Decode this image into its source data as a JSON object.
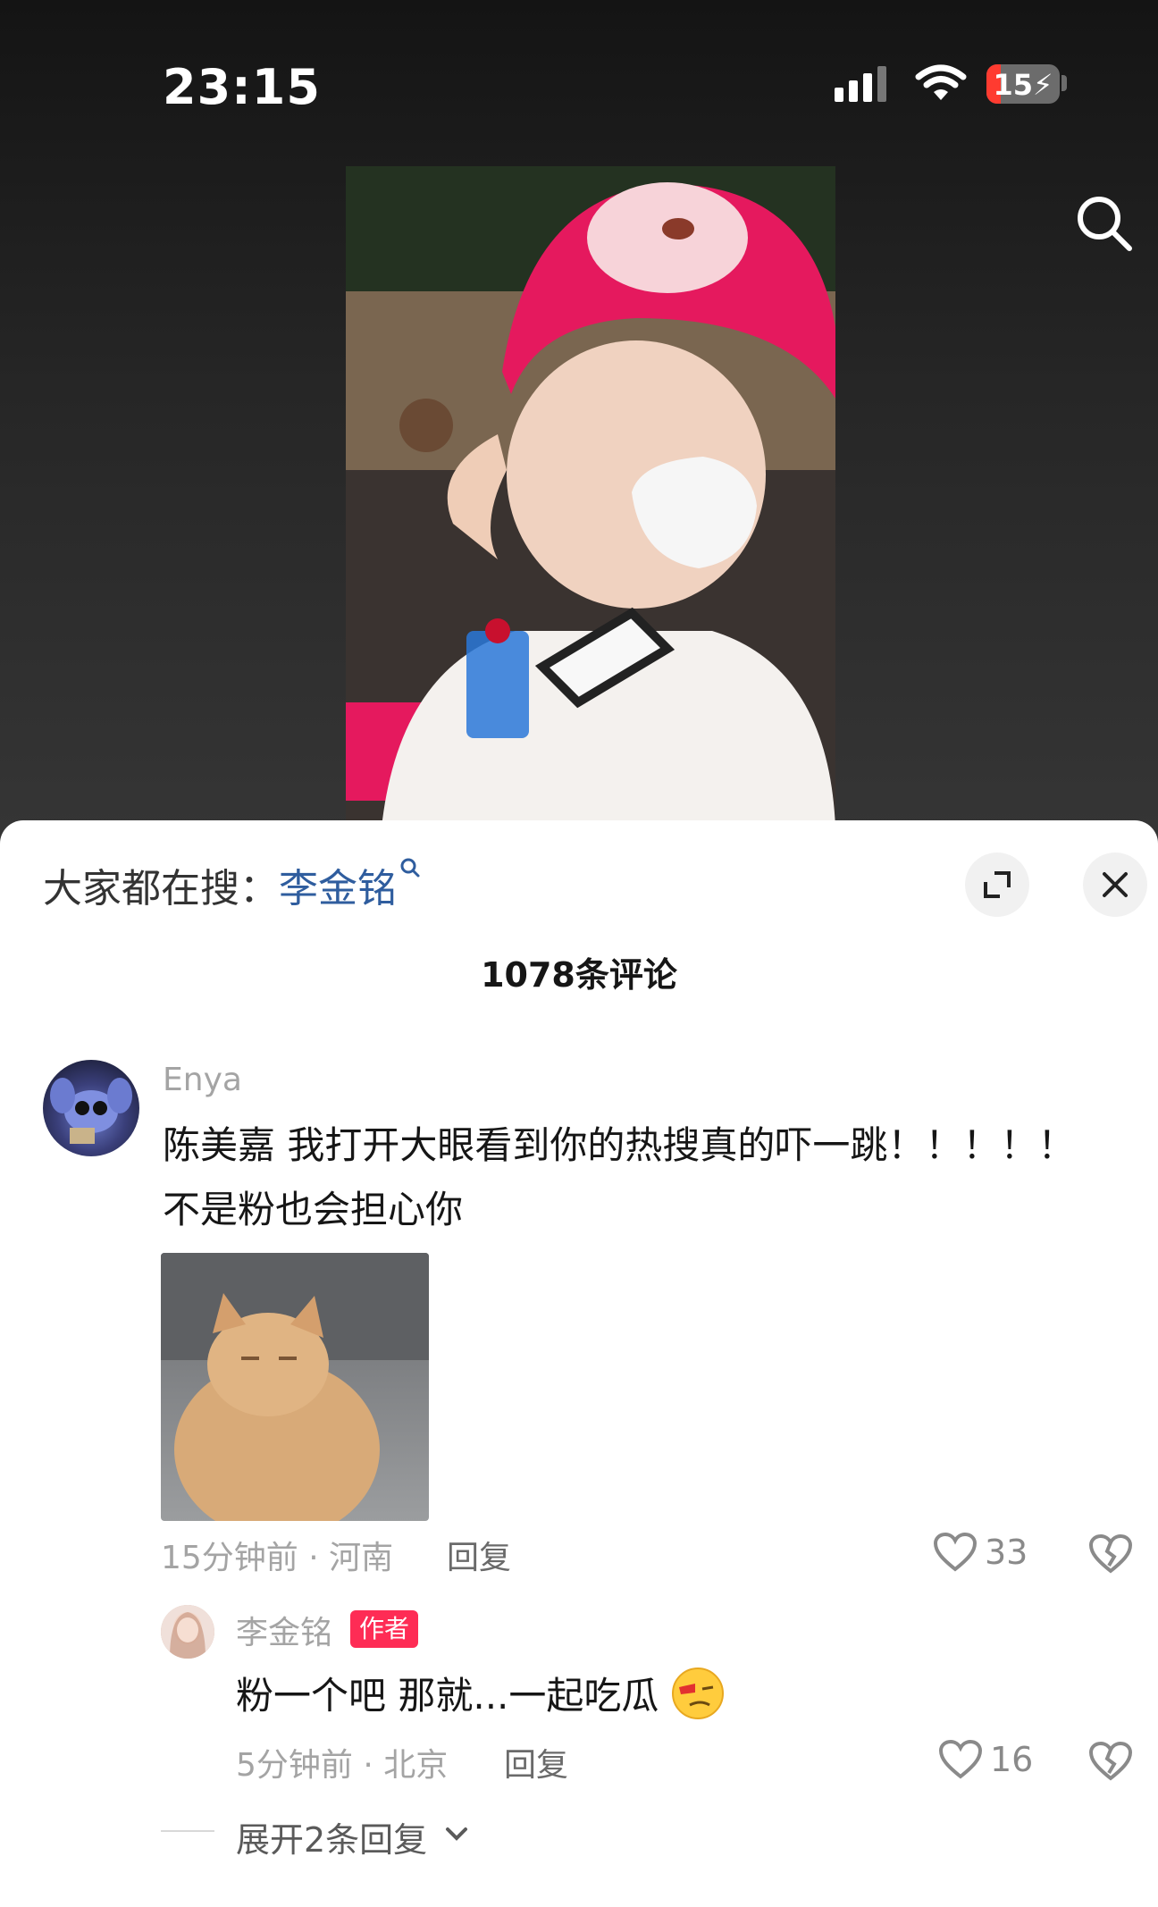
{
  "status_bar": {
    "time": "23:15",
    "battery": "15",
    "icons": [
      "signal-icon",
      "wifi-icon",
      "battery-charging-icon"
    ]
  },
  "header": {
    "search_icon": "search-icon"
  },
  "comments_panel": {
    "hot_search_prefix": "大家都在搜：",
    "hot_search_keyword": "李金铭",
    "comment_count": "1078条评论",
    "icons": [
      "expand-icon",
      "close-icon"
    ]
  },
  "comments": [
    {
      "username": "Enya",
      "text_line1": "陈美嘉 我打开大眼看到你的热搜真的吓一跳！！！！！",
      "text_line2": "不是粉也会担心你",
      "meta": "15分钟前 · 河南",
      "reply_label": "回复",
      "likes": "33"
    }
  ],
  "author_reply": {
    "username": "李金铭",
    "badge": "作者",
    "text": "粉一个吧 那就...一起吃瓜",
    "meta": "5分钟前 · 北京",
    "reply_label": "回复",
    "likes": "16"
  },
  "expand_replies": "展开2条回复",
  "colors": {
    "link_blue": "#2f5d9e",
    "author_badge": "#fe2c55",
    "helmet_pink": "#e5195e"
  }
}
